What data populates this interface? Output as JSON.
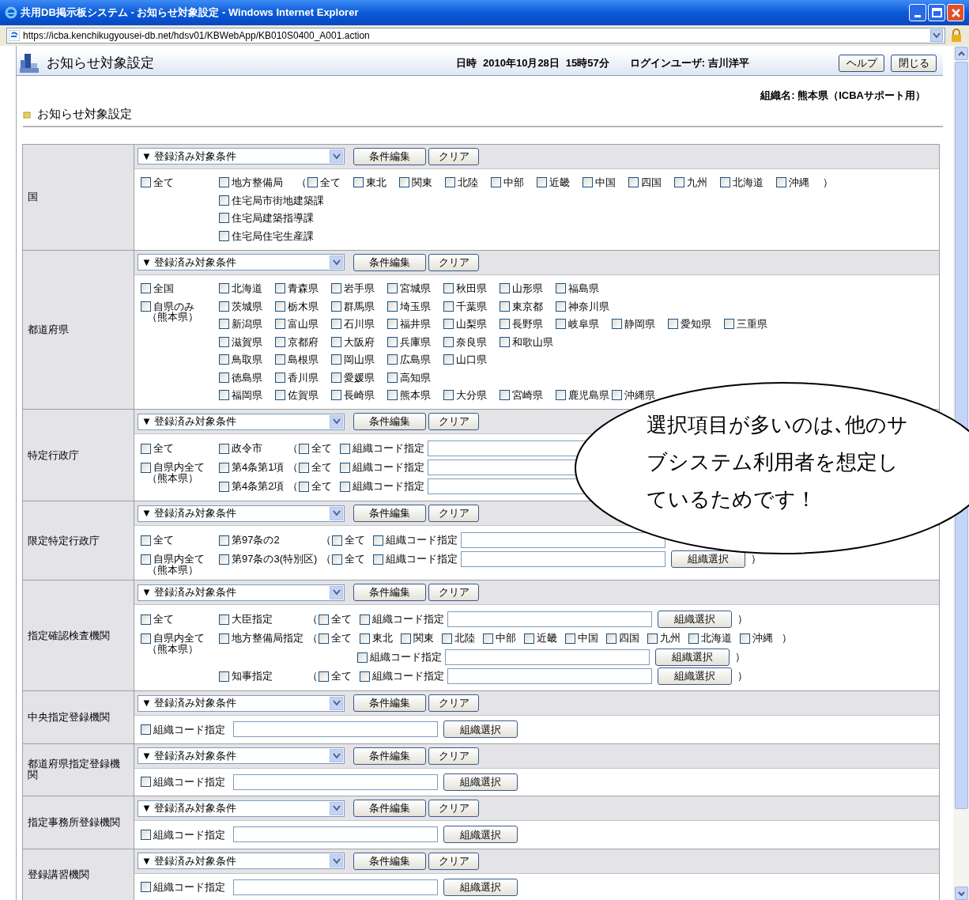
{
  "window": {
    "title": "共用DB掲示板システム - お知らせ対象設定 - Windows Internet Explorer",
    "address": "https://icba.kenchikugyousei-db.net/hdsv01/KBWebApp/KB010S0400_A001.action"
  },
  "header": {
    "title": "お知らせ対象設定",
    "datetime_label": "日時",
    "date": "2010年10月28日",
    "time": "15時57分",
    "login": "ログインユーザ: 吉川洋平",
    "buttons": [
      "ヘルプ",
      "閉じる"
    ]
  },
  "organization": "組織名: 熊本県（ICBAサポート用）",
  "subtitle": "お知らせ対象設定",
  "sections": [
    {
      "label": "国",
      "condition": "▼ 登録済み対象条件",
      "edit": "条件編集",
      "clear": "クリア",
      "kind": "flow",
      "left": [
        {
          "label": "全て",
          "checked": false
        }
      ],
      "lines": [
        {
          "items": [
            {
              "kind": "check",
              "label": "地方整備局",
              "checked": false
            },
            {
              "kind": "paren",
              "text": "（"
            },
            {
              "kind": "check",
              "label": "全て",
              "checked": false
            },
            {
              "kind": "check",
              "label": "東北",
              "checked": false
            },
            {
              "kind": "check",
              "label": "関東",
              "checked": false
            },
            {
              "kind": "check",
              "label": "北陸",
              "checked": false
            },
            {
              "kind": "check",
              "label": "中部",
              "checked": false
            },
            {
              "kind": "check",
              "label": "近畿",
              "checked": false
            },
            {
              "kind": "check",
              "label": "中国",
              "checked": false
            },
            {
              "kind": "check",
              "label": "四国",
              "checked": false
            },
            {
              "kind": "check",
              "label": "九州",
              "checked": false
            },
            {
              "kind": "check",
              "label": "北海道",
              "checked": false
            },
            {
              "kind": "check",
              "label": "沖縄",
              "checked": false
            },
            {
              "kind": "paren",
              "text": "）"
            }
          ]
        },
        {
          "items": [
            {
              "kind": "check",
              "label": "住宅局市街地建築課",
              "checked": false
            }
          ]
        },
        {
          "items": [
            {
              "kind": "check",
              "label": "住宅局建築指導課",
              "checked": false
            }
          ]
        },
        {
          "items": [
            {
              "kind": "check",
              "label": "住宅局住宅生産課",
              "checked": false
            }
          ]
        }
      ]
    },
    {
      "label": "都道府県",
      "condition": "▼ 登録済み対象条件",
      "edit": "条件編集",
      "clear": "クリア",
      "kind": "grid",
      "left": [
        {
          "label": "全国",
          "checked": false
        },
        {
          "label": "自県のみ",
          "checked": false,
          "note": "（熊本県）"
        }
      ],
      "lines": [
        {
          "items": [
            {
              "kind": "check",
              "label": "北海道",
              "checked": false
            },
            {
              "kind": "check",
              "label": "青森県",
              "checked": false
            },
            {
              "kind": "check",
              "label": "岩手県",
              "checked": false
            },
            {
              "kind": "check",
              "label": "宮城県",
              "checked": false
            },
            {
              "kind": "check",
              "label": "秋田県",
              "checked": false
            },
            {
              "kind": "check",
              "label": "山形県",
              "checked": false
            },
            {
              "kind": "check",
              "label": "福島県",
              "checked": false
            }
          ]
        },
        {
          "items": [
            {
              "kind": "check",
              "label": "茨城県",
              "checked": false
            },
            {
              "kind": "check",
              "label": "栃木県",
              "checked": false
            },
            {
              "kind": "check",
              "label": "群馬県",
              "checked": false
            },
            {
              "kind": "check",
              "label": "埼玉県",
              "checked": false
            },
            {
              "kind": "check",
              "label": "千葉県",
              "checked": false
            },
            {
              "kind": "check",
              "label": "東京都",
              "checked": false
            },
            {
              "kind": "check",
              "label": "神奈川県",
              "checked": false
            }
          ]
        },
        {
          "items": [
            {
              "kind": "check",
              "label": "新潟県",
              "checked": false
            },
            {
              "kind": "check",
              "label": "富山県",
              "checked": false
            },
            {
              "kind": "check",
              "label": "石川県",
              "checked": false
            },
            {
              "kind": "check",
              "label": "福井県",
              "checked": false
            },
            {
              "kind": "check",
              "label": "山梨県",
              "checked": false
            },
            {
              "kind": "check",
              "label": "長野県",
              "checked": false
            },
            {
              "kind": "check",
              "label": "岐阜県",
              "checked": false
            },
            {
              "kind": "check",
              "label": "静岡県",
              "checked": false
            },
            {
              "kind": "check",
              "label": "愛知県",
              "checked": false
            },
            {
              "kind": "check",
              "label": "三重県",
              "checked": false
            }
          ]
        },
        {
          "items": [
            {
              "kind": "check",
              "label": "滋賀県",
              "checked": false
            },
            {
              "kind": "check",
              "label": "京都府",
              "checked": false
            },
            {
              "kind": "check",
              "label": "大阪府",
              "checked": false
            },
            {
              "kind": "check",
              "label": "兵庫県",
              "checked": false
            },
            {
              "kind": "check",
              "label": "奈良県",
              "checked": false
            },
            {
              "kind": "check",
              "label": "和歌山県",
              "checked": false
            }
          ]
        },
        {
          "items": [
            {
              "kind": "check",
              "label": "鳥取県",
              "checked": false
            },
            {
              "kind": "check",
              "label": "島根県",
              "checked": false
            },
            {
              "kind": "check",
              "label": "岡山県",
              "checked": false
            },
            {
              "kind": "check",
              "label": "広島県",
              "checked": false
            },
            {
              "kind": "check",
              "label": "山口県",
              "checked": false
            }
          ]
        },
        {
          "items": [
            {
              "kind": "check",
              "label": "徳島県",
              "checked": false
            },
            {
              "kind": "check",
              "label": "香川県",
              "checked": false
            },
            {
              "kind": "check",
              "label": "愛媛県",
              "checked": false
            },
            {
              "kind": "check",
              "label": "高知県",
              "checked": false
            }
          ]
        },
        {
          "items": [
            {
              "kind": "check",
              "label": "福岡県",
              "checked": false
            },
            {
              "kind": "check",
              "label": "佐賀県",
              "checked": false
            },
            {
              "kind": "check",
              "label": "長崎県",
              "checked": false
            },
            {
              "kind": "check",
              "label": "熊本県",
              "checked": false
            },
            {
              "kind": "check",
              "label": "大分県",
              "checked": false
            },
            {
              "kind": "check",
              "label": "宮崎県",
              "checked": false
            },
            {
              "kind": "check",
              "label": "鹿児島県",
              "checked": false
            },
            {
              "kind": "check",
              "label": "沖縄県",
              "checked": false
            }
          ]
        }
      ]
    },
    {
      "label": "特定行政庁",
      "condition": "▼ 登録済み対象条件",
      "edit": "条件編集",
      "clear": "クリア",
      "kind": "table",
      "left": [
        {
          "label": "全て",
          "checked": false
        },
        {
          "label": "自県内全て",
          "checked": false,
          "note": "（熊本県）"
        }
      ],
      "lines": [
        {
          "kind": "main",
          "lead": {
            "label": "政令市",
            "checked": false
          },
          "items": [
            {
              "kind": "paren",
              "text": "（"
            },
            {
              "kind": "check",
              "label": "全て",
              "checked": false
            },
            {
              "kind": "check",
              "label": "組織コード指定",
              "checked": false
            },
            {
              "kind": "input"
            }
          ]
        },
        {
          "kind": "main",
          "lead": {
            "label": "第4条第1項",
            "checked": false
          },
          "items": [
            {
              "kind": "paren",
              "text": "（"
            },
            {
              "kind": "check",
              "label": "全て",
              "checked": false
            },
            {
              "kind": "check",
              "label": "組織コード指定",
              "checked": false
            },
            {
              "kind": "input"
            }
          ]
        },
        {
          "kind": "main",
          "lead": {
            "label": "第4条第2項",
            "checked": false
          },
          "items": [
            {
              "kind": "paren",
              "text": "（"
            },
            {
              "kind": "check",
              "label": "全て",
              "checked": false
            },
            {
              "kind": "check",
              "label": "組織コード指定",
              "checked": false
            },
            {
              "kind": "input"
            }
          ]
        }
      ]
    },
    {
      "label": "限定特定行政庁",
      "condition": "▼ 登録済み対象条件",
      "edit": "条件編集",
      "clear": "クリア",
      "kind": "table",
      "left": [
        {
          "label": "全て",
          "checked": false
        },
        {
          "label": "自県内全て",
          "checked": false,
          "note": "（熊本県）"
        }
      ],
      "lines": [
        {
          "kind": "main",
          "lead": {
            "label": "第97条の2",
            "checked": false
          },
          "items": [
            {
              "kind": "paren",
              "text": "（"
            },
            {
              "kind": "check",
              "label": "全て",
              "checked": false
            },
            {
              "kind": "check",
              "label": "組織コード指定",
              "checked": false
            },
            {
              "kind": "input"
            }
          ]
        },
        {
          "kind": "main",
          "lead": {
            "label": "第97条の3(特別区)",
            "checked": false
          },
          "items": [
            {
              "kind": "paren",
              "text": "（"
            },
            {
              "kind": "check",
              "label": "全て",
              "checked": false
            },
            {
              "kind": "check",
              "label": "組織コード指定",
              "checked": false
            },
            {
              "kind": "input"
            },
            {
              "kind": "button",
              "label": "組織選択"
            },
            {
              "kind": "paren",
              "text": "）"
            }
          ]
        }
      ]
    },
    {
      "label": "指定確認検査機関",
      "condition": "▼ 登録済み対象条件",
      "edit": "条件編集",
      "clear": "クリア",
      "kind": "table",
      "left": [
        {
          "label": "全て",
          "checked": false
        },
        {
          "label": "自県内全て",
          "checked": false,
          "note": "（熊本県）"
        }
      ],
      "lines": [
        {
          "kind": "main",
          "lead": {
            "label": "大臣指定",
            "checked": false
          },
          "items": [
            {
              "kind": "paren",
              "text": "（"
            },
            {
              "kind": "check",
              "label": "全て",
              "checked": false
            },
            {
              "kind": "check",
              "label": "組織コード指定",
              "checked": false
            },
            {
              "kind": "input"
            },
            {
              "kind": "button",
              "label": "組織選択"
            },
            {
              "kind": "paren",
              "text": "）"
            }
          ]
        },
        {
          "kind": "main",
          "lead": {
            "label": "地方整備局指定",
            "checked": false
          },
          "items": [
            {
              "kind": "paren",
              "text": "（"
            },
            {
              "kind": "check",
              "label": "全て",
              "checked": false
            },
            {
              "kind": "check",
              "label": "東北",
              "checked": false
            },
            {
              "kind": "check",
              "label": "関東",
              "checked": false
            },
            {
              "kind": "check",
              "label": "北陸",
              "checked": false
            },
            {
              "kind": "check",
              "label": "中部",
              "checked": false
            },
            {
              "kind": "check",
              "label": "近畿",
              "checked": false
            },
            {
              "kind": "check",
              "label": "中国",
              "checked": false
            },
            {
              "kind": "check",
              "label": "四国",
              "checked": false
            },
            {
              "kind": "check",
              "label": "九州",
              "checked": false
            },
            {
              "kind": "check",
              "label": "北海道",
              "checked": false
            },
            {
              "kind": "check",
              "label": "沖縄",
              "checked": false
            },
            {
              "kind": "paren",
              "text": "）"
            }
          ]
        },
        {
          "kind": "continuation",
          "items": [
            {
              "kind": "check",
              "label": "組織コード指定",
              "checked": false
            },
            {
              "kind": "input"
            },
            {
              "kind": "button",
              "label": "組織選択"
            },
            {
              "kind": "paren",
              "text": "）"
            }
          ]
        },
        {
          "kind": "main",
          "lead": {
            "label": "知事指定",
            "checked": false
          },
          "items": [
            {
              "kind": "paren",
              "text": "（"
            },
            {
              "kind": "check",
              "label": "全て",
              "checked": false
            },
            {
              "kind": "check",
              "label": "組織コード指定",
              "checked": false
            },
            {
              "kind": "input"
            },
            {
              "kind": "button",
              "label": "組織選択"
            },
            {
              "kind": "paren",
              "text": "）"
            }
          ]
        }
      ]
    },
    {
      "label": "中央指定登録機関",
      "condition": "▼ 登録済み対象条件",
      "edit": "条件編集",
      "clear": "クリア",
      "kind": "flow",
      "lines": [
        {
          "items": [
            {
              "kind": "check",
              "label": "組織コード指定",
              "checked": false
            },
            {
              "kind": "input"
            },
            {
              "kind": "button",
              "label": "組織選択"
            }
          ]
        }
      ]
    },
    {
      "label": "都道府県指定登録機関",
      "condition": "▼ 登録済み対象条件",
      "edit": "条件編集",
      "clear": "クリア",
      "kind": "flow",
      "lines": [
        {
          "items": [
            {
              "kind": "check",
              "label": "組織コード指定",
              "checked": false
            },
            {
              "kind": "input"
            },
            {
              "kind": "button",
              "label": "組織選択"
            }
          ]
        }
      ]
    },
    {
      "label": "指定事務所登録機関",
      "condition": "▼ 登録済み対象条件",
      "edit": "条件編集",
      "clear": "クリア",
      "kind": "flow",
      "lines": [
        {
          "items": [
            {
              "kind": "check",
              "label": "組織コード指定",
              "checked": false
            },
            {
              "kind": "input"
            },
            {
              "kind": "button",
              "label": "組織選択"
            }
          ]
        }
      ]
    },
    {
      "label": "登録講習機関",
      "condition": "▼ 登録済み対象条件",
      "edit": "条件編集",
      "clear": "クリア",
      "kind": "flow",
      "lines": [
        {
          "items": [
            {
              "kind": "check",
              "label": "組織コード指定",
              "checked": false
            },
            {
              "kind": "input"
            },
            {
              "kind": "button",
              "label": "組織選択"
            }
          ]
        }
      ]
    }
  ],
  "callout": {
    "lines": [
      "選択項目が多いのは､他のサ",
      "ブシステム利用者を想定し",
      "ているためです！"
    ]
  }
}
